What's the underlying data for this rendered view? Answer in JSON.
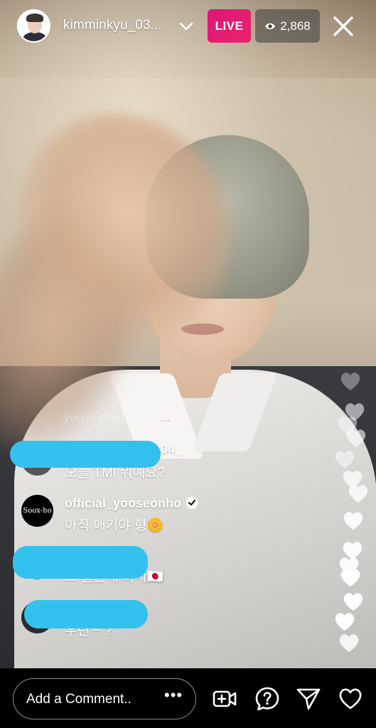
{
  "header": {
    "username": "kimminkyu_03...",
    "live_label": "LIVE",
    "viewer_count": "2,868"
  },
  "ghost_comment": {
    "text": "you in philippines",
    "tail": "..."
  },
  "comments": [
    {
      "username": "04_",
      "text": "오늘 TMI 뭐예요?",
      "redacted": true
    },
    {
      "username": "official_yooseonho",
      "text": "아직 애기야 형🌼",
      "verified": true,
      "avatar_text": "Soox-ho"
    },
    {
      "username": "",
      "text": "그 일본에 와서🇯🇵",
      "redacted": true
    },
    {
      "username": "",
      "text": "우린 ~ ?",
      "redacted": true
    }
  ],
  "bottom_bar": {
    "comment_placeholder": "Add a Comment..",
    "more_label": "•••"
  },
  "colors": {
    "live": "#e0157a",
    "redaction": "#33c1ee",
    "background": "#000000"
  },
  "icons": [
    "chevron-down-icon",
    "eye-icon",
    "close-icon",
    "verified-icon",
    "video-add-icon",
    "question-icon",
    "send-icon",
    "heart-icon"
  ]
}
